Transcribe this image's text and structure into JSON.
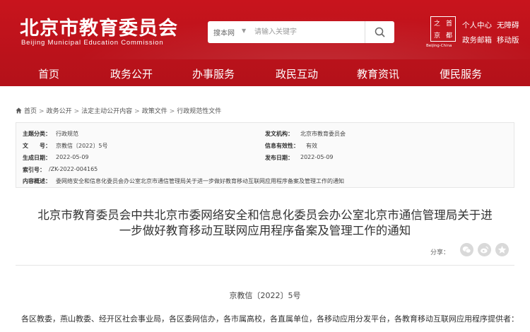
{
  "header": {
    "logo_cn": "北京市教育委员会",
    "logo_en": "Beijing Municipal Education Commission",
    "search": {
      "scope": "搜本网",
      "placeholder": "请输入关键字"
    },
    "emblem": {
      "chars": [
        "之",
        "首",
        "京",
        "都"
      ],
      "caption": "Beijing-China"
    },
    "quick_links": [
      "个人中心",
      "无障碍",
      "政务邮箱",
      "移动版"
    ]
  },
  "nav": [
    "首页",
    "政务公开",
    "办事服务",
    "政民互动",
    "教育资讯",
    "便民服务"
  ],
  "breadcrumb": [
    "首页",
    "政务公开",
    "法定主动公开内容",
    "政策文件",
    "行政规范性文件"
  ],
  "meta": {
    "category_label": "主题分类：",
    "category": "行政规范",
    "issuer_label": "发文机构：",
    "issuer": "北京市教育委员会",
    "docno_label": "文　　号：",
    "docno": "京教信〔2022〕5号",
    "status_label": "信息有效性：",
    "status": "有效",
    "created_label": "生成日期：",
    "created": "2022-05-09",
    "published_label": "发布日期：",
    "published": "2022-05-09",
    "index_label": "索引号：",
    "index": "/ZK-2022-004165",
    "summary_label": "内容概述：",
    "summary": "委网络安全和信息化委员会办公室北京市通信管理局关于进一步做好教育移动互联网应用程序备案及管理工作的通知"
  },
  "article": {
    "title_line1": "北京市教育委员会中共北京市委网络安全和信息化委员会办公室北京市通信管理局关于进",
    "title_line2": "一步做好教育移动互联网应用程序备案及管理工作的通知",
    "share_label": "分享：",
    "doc_number": "京教信〔2022〕5号",
    "addressees": "各区教委，燕山教委、经开区社会事业局，各区委网信办，各市属高校，各直属单位，各移动应用分发平台，各教育移动互联网应用程序提供者："
  },
  "colors": {
    "brand_red": "#c8141d",
    "share_icon_bg": "#d9d9d9"
  }
}
